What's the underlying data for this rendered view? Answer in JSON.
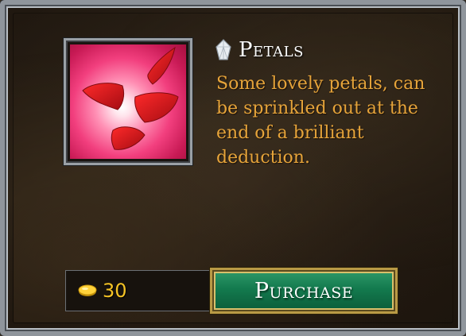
{
  "item": {
    "name": "Petals",
    "description": "Some lovely petals, can be sprinkled out at the end of a brilliant deduction.",
    "thumbnail_icon": "rose-petals-image",
    "title_icon": "gem-icon"
  },
  "price": {
    "amount": "30",
    "currency_icon": "gold-coin-icon"
  },
  "actions": {
    "purchase_label": "Purchase"
  },
  "colors": {
    "title": "#ffffff",
    "description": "#e6a43a",
    "price": "#f5c325",
    "button_green": "#137a4e",
    "frame_gold": "#b99a45"
  }
}
